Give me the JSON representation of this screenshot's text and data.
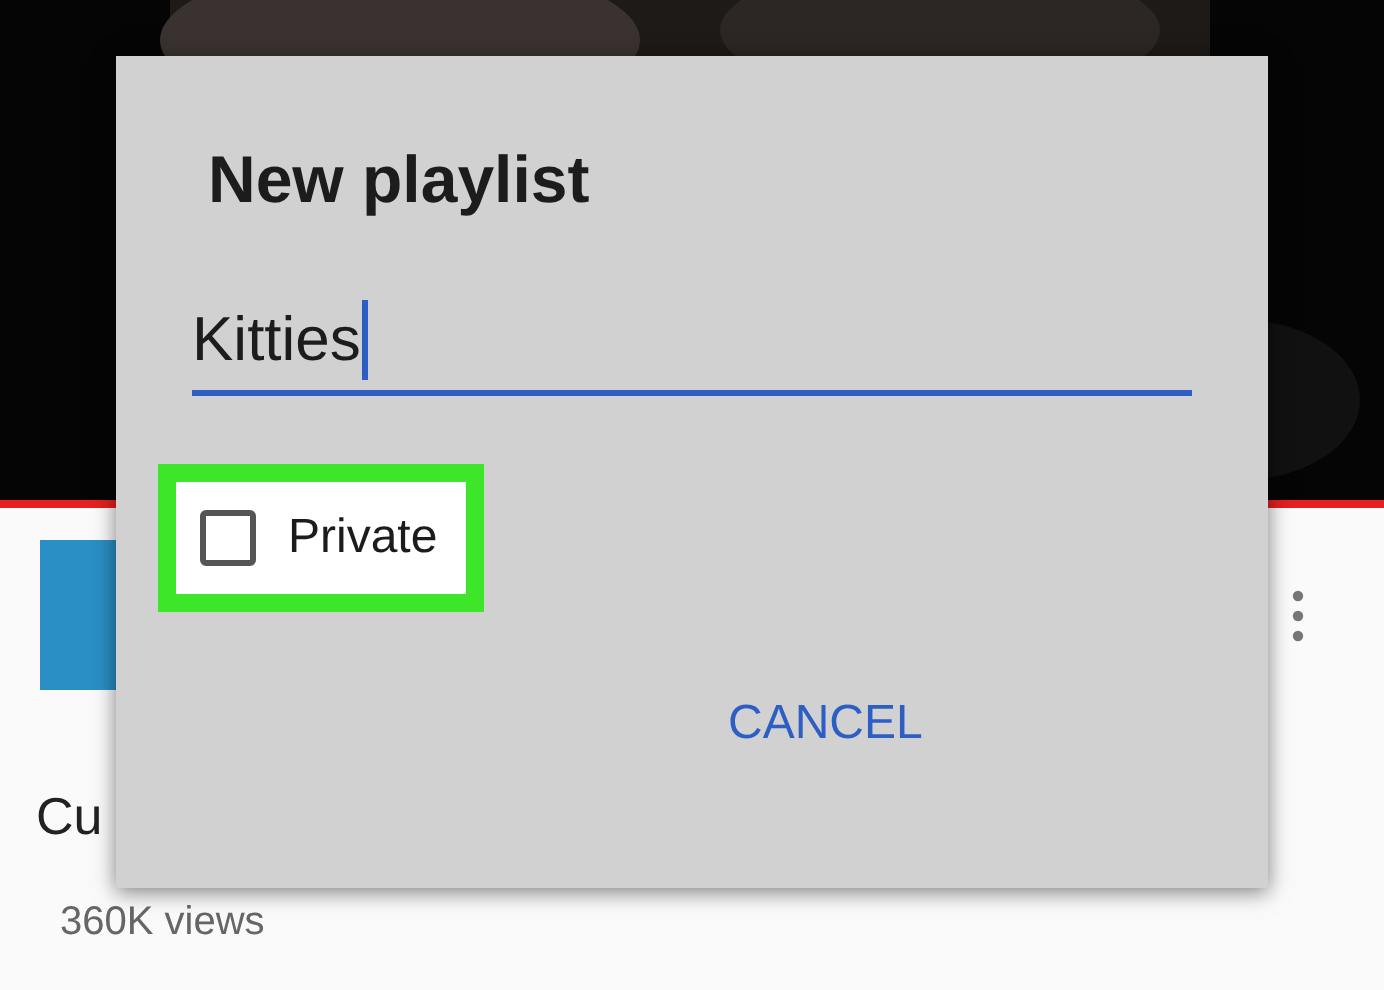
{
  "background": {
    "video_title": "Cu",
    "views": "360K views"
  },
  "dialog": {
    "title": "New playlist",
    "name_field": {
      "value": "Kitties",
      "focused": true
    },
    "private": {
      "label": "Private",
      "checked": false,
      "highlighted": true
    },
    "buttons": [
      "CANCEL"
    ]
  }
}
